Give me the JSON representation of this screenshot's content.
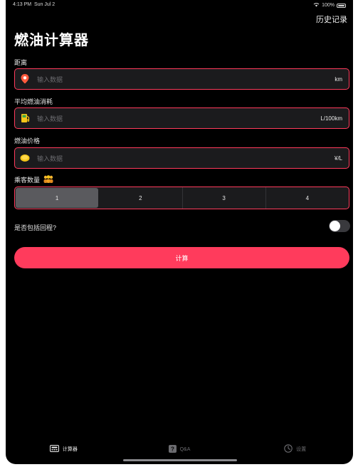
{
  "status_bar": {
    "time": "4:13 PM",
    "date": "Sun Jul 2",
    "battery": "100%"
  },
  "header": {
    "history_label": "历史记录",
    "title": "燃油计算器"
  },
  "fields": [
    {
      "label": "距离",
      "placeholder": "输入数据",
      "unit": "km",
      "icon": "map-pin-icon"
    },
    {
      "label": "平均燃油消耗",
      "placeholder": "输入数据",
      "unit": "L/100km",
      "icon": "fuel-pump-icon"
    },
    {
      "label": "燃油价格",
      "placeholder": "输入数据",
      "unit": "¥/L",
      "icon": "coin-icon"
    }
  ],
  "passengers": {
    "label": "乘客数量",
    "icon": "people-icon",
    "options": [
      "1",
      "2",
      "3",
      "4"
    ],
    "selected": "1"
  },
  "round_trip": {
    "label": "是否包括回程?",
    "enabled": false
  },
  "calculate_button": {
    "label": "计算"
  },
  "tabbar": {
    "tabs": [
      {
        "label": "计算器",
        "icon": "calculator-icon",
        "active": true
      },
      {
        "label": "Q&A",
        "icon": "question-icon",
        "active": false
      },
      {
        "label": "设置",
        "icon": "settings-icon",
        "active": false
      }
    ]
  },
  "colors": {
    "accent": "#ff3b5c",
    "background": "#000000",
    "field_background": "#1b1b1d"
  }
}
